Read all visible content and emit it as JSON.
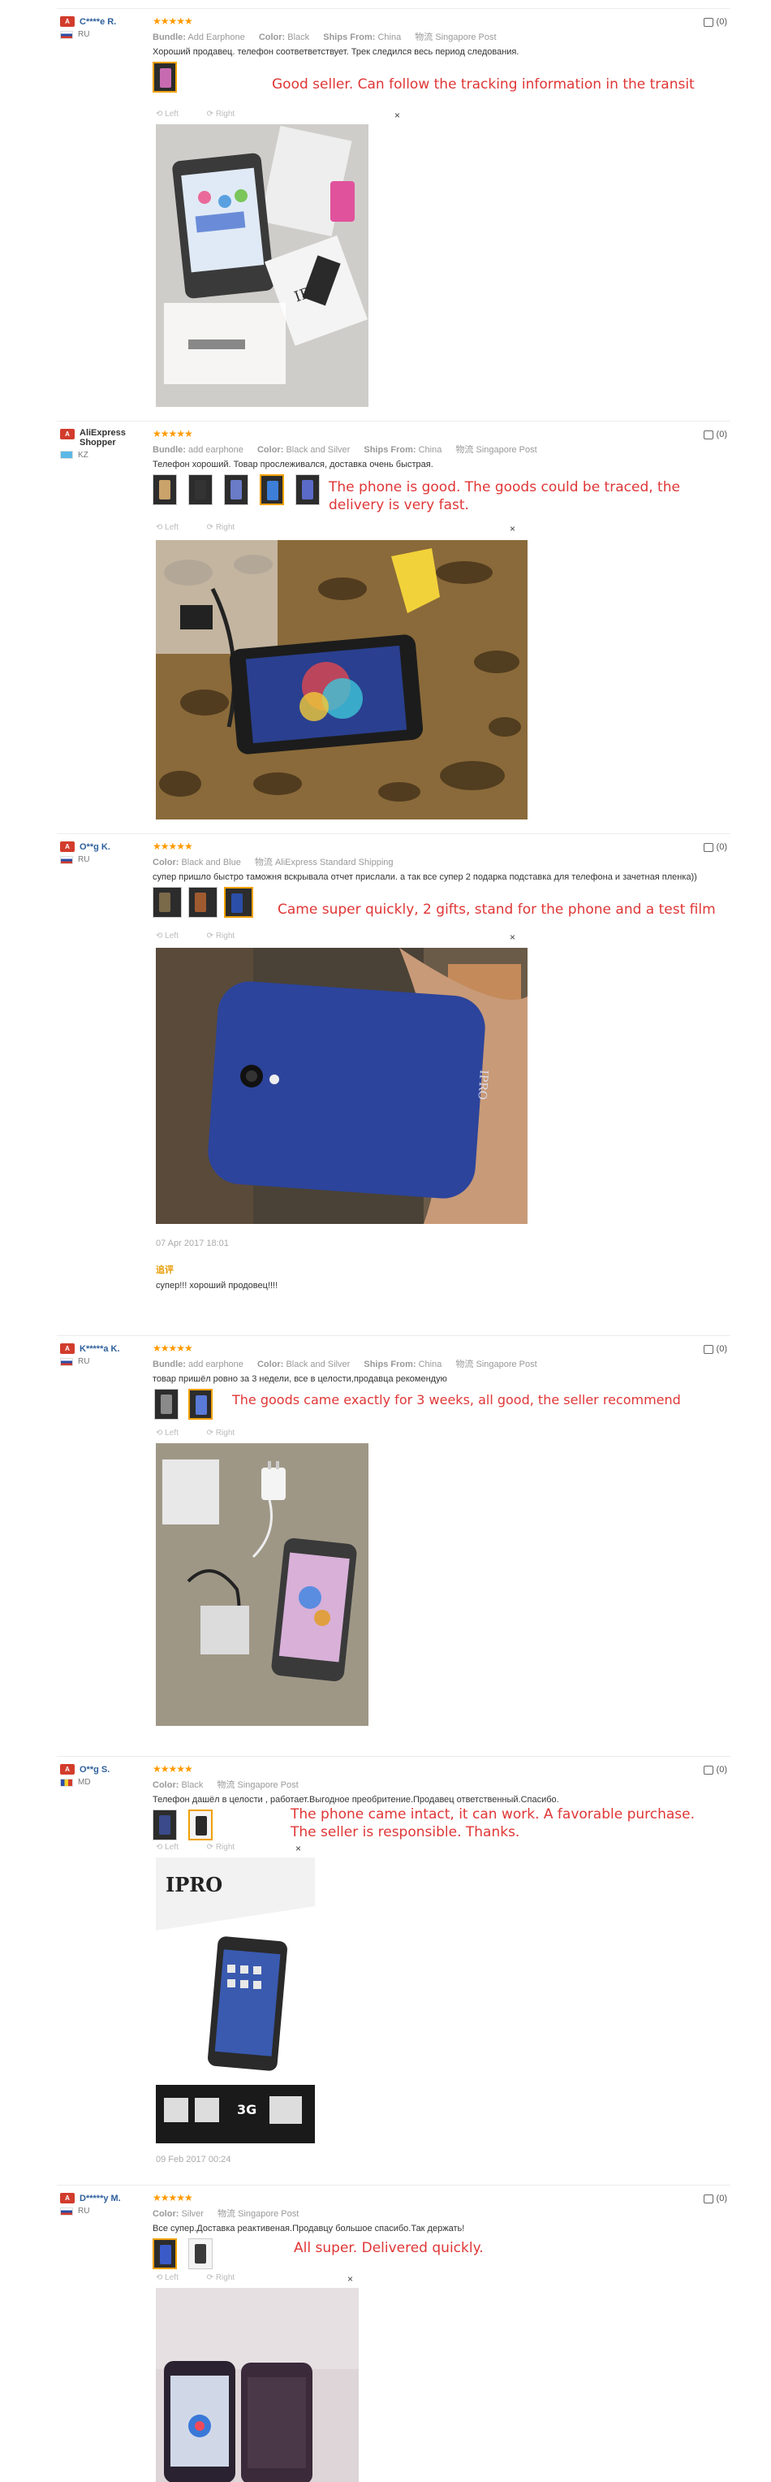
{
  "viewer": {
    "prev_label": "Left",
    "next_label": "Right",
    "close_label": "×"
  },
  "reviews": [
    {
      "user": "C****e R.",
      "country": "RU",
      "stars": "★★★★★",
      "meta": [
        {
          "key": "Bundle:",
          "val": "Add Earphone"
        },
        {
          "key": "Color:",
          "val": "Black"
        },
        {
          "key": "Ships From:",
          "val": "China"
        }
      ],
      "shipping": "物流 Singapore Post",
      "text": "Хороший продавец. телефон соответветствует. Трек следился весь период следования.",
      "translation": "Good seller. Can follow the tracking information in the transit",
      "likes": "(0)"
    },
    {
      "user": "AliExpress Shopper",
      "country": "KZ",
      "stars": "★★★★★",
      "meta": [
        {
          "key": "Bundle:",
          "val": "add earphone"
        },
        {
          "key": "Color:",
          "val": "Black and Silver"
        },
        {
          "key": "Ships From:",
          "val": "China"
        }
      ],
      "shipping": "物流 Singapore Post",
      "text": "Телефон хороший. Товар прослеживался, доставка очень быстрая.",
      "translation": "The phone is good. The goods could be traced, the delivery is very fast.",
      "likes": "(0)"
    },
    {
      "user": "O**g K.",
      "country": "RU",
      "stars": "★★★★★",
      "meta": [
        {
          "key": "Color:",
          "val": "Black and Blue"
        }
      ],
      "shipping": "物流 AliExpress Standard Shipping",
      "text": "супер пришло быстро таможня вскрывала отчет прислали. а так все супер 2 подарка подставка для телефона и зачетная пленка))",
      "translation": "Came super quickly, 2 gifts, stand for the phone and a test film",
      "likes": "(0)",
      "date": "07 Apr 2017 18:01",
      "additional_label": "追评",
      "additional_text": "супер!!! хороший продовец!!!!"
    },
    {
      "user": "K*****a K.",
      "country": "RU",
      "stars": "★★★★★",
      "meta": [
        {
          "key": "Bundle:",
          "val": "add earphone"
        },
        {
          "key": "Color:",
          "val": "Black and Silver"
        },
        {
          "key": "Ships From:",
          "val": "China"
        }
      ],
      "shipping": "物流 Singapore Post",
      "text": "товар пришёл ровно за 3 недели, все в целости,продавца рекомендую",
      "translation": "The goods came exactly for 3 weeks, all good, the seller recommend",
      "likes": "(0)"
    },
    {
      "user": "O**g S.",
      "country": "MD",
      "stars": "★★★★★",
      "meta": [
        {
          "key": "Color:",
          "val": "Black"
        }
      ],
      "shipping": "物流 Singapore Post",
      "text": "Телефон дашёл в целости , работает.Выгодное преобритение.Продавец ответственный.Спасибо.",
      "translation": "The phone came intact, it can work. A favorable purchase. The seller is responsible. Thanks.",
      "likes": "(0)",
      "date": "09 Feb 2017 00:24"
    },
    {
      "user": "D*****y M.",
      "country": "RU",
      "stars": "★★★★★",
      "meta": [
        {
          "key": "Color:",
          "val": "Silver"
        }
      ],
      "shipping": "物流 Singapore Post",
      "text": "Все супер.Доставка реактивеная.Продавцу большое спасибо.Так держать!",
      "translation": "All super. Delivered quickly.",
      "likes": "(0)"
    }
  ],
  "photo_texts": {
    "box_brand": "IPRO",
    "box_3g": "3G"
  }
}
